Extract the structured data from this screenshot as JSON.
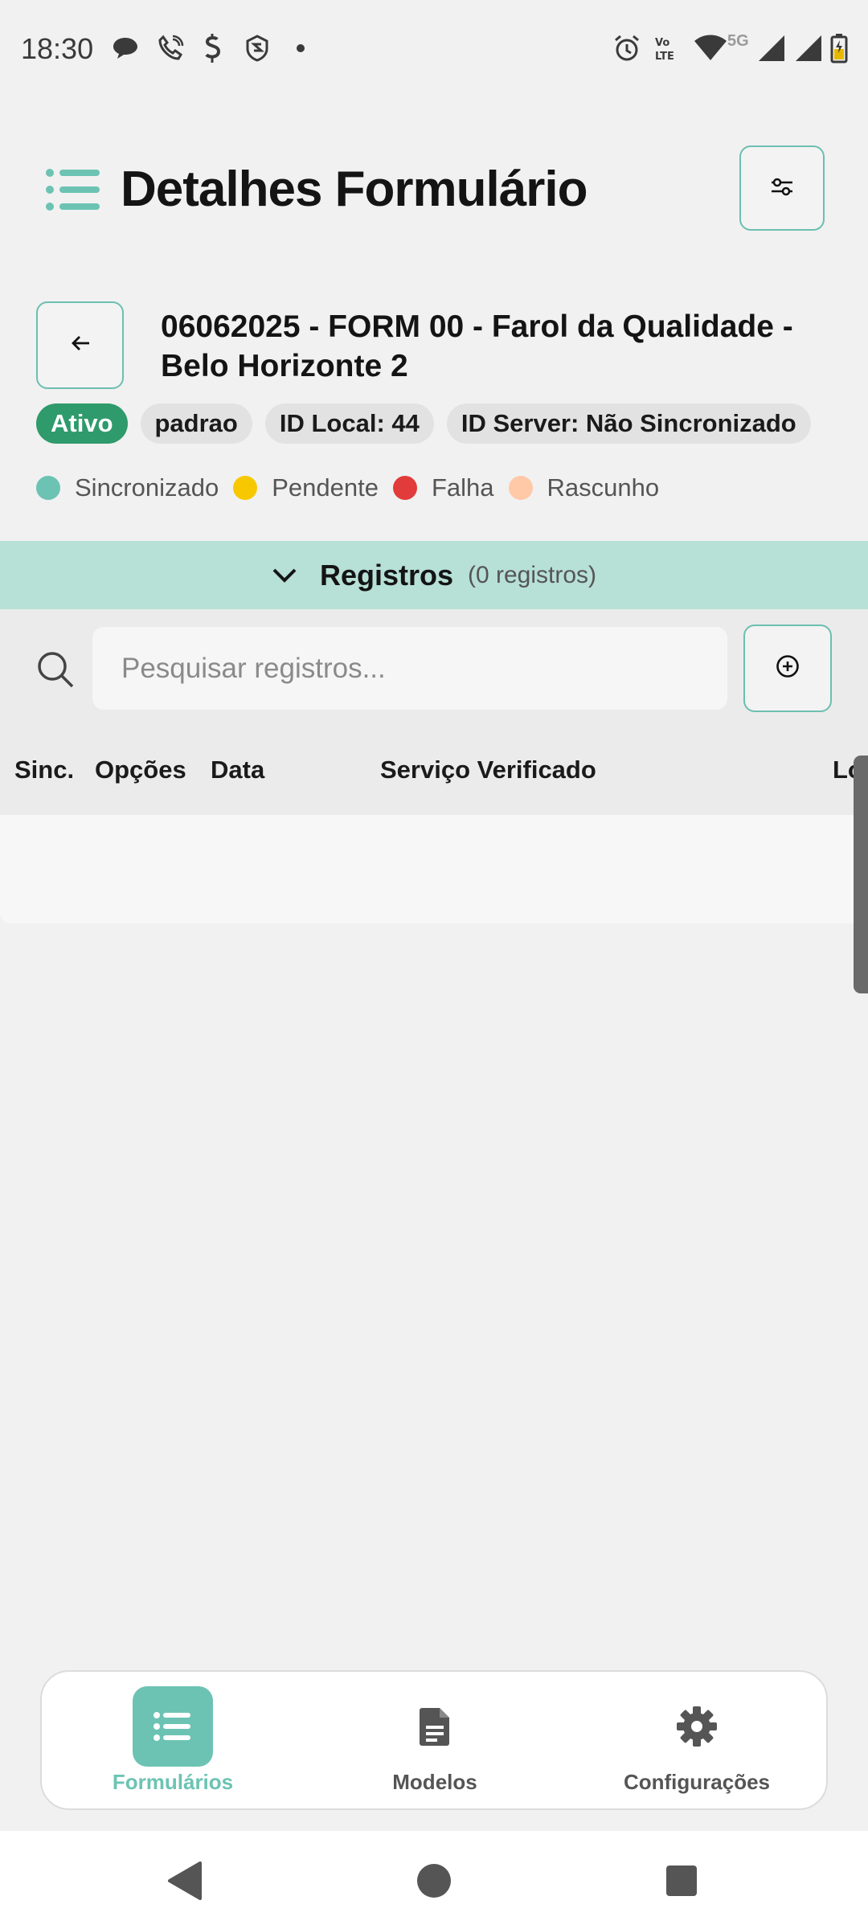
{
  "status_bar": {
    "time": "18:30",
    "network_label": "5G",
    "left_icons": [
      "chat-bubble-icon",
      "phone-call-icon",
      "dollar-s-icon",
      "shield-s-icon",
      "notification-dot-icon"
    ],
    "right_icons": [
      "alarm-icon",
      "volte-icon",
      "wifi-icon",
      "signal-icon",
      "signal-icon",
      "battery-charging-icon"
    ]
  },
  "header": {
    "title": "Detalhes Formulário",
    "menu_icon": "menu-list-icon",
    "filter_icon": "sliders-icon"
  },
  "form": {
    "back_icon": "arrow-left-icon",
    "title": "06062025 - FORM 00 - Farol da Qualidade - Belo Horizonte 2",
    "chips": {
      "status": "Ativo",
      "type": "padrao",
      "local_id": "ID Local: 44",
      "server_id": "ID Server: Não Sincronizado"
    },
    "legend": [
      {
        "label": "Sincronizado",
        "color": "#6cc3b3"
      },
      {
        "label": "Pendente",
        "color": "#f7c800"
      },
      {
        "label": "Falha",
        "color": "#e23b3b"
      },
      {
        "label": "Rascunho",
        "color": "#ffc9a8"
      }
    ]
  },
  "registros": {
    "title": "Registros",
    "count": "(0 registros)",
    "icon": "chevron-down-icon"
  },
  "search": {
    "placeholder": "Pesquisar registros...",
    "value": "",
    "add_icon": "plus-circle-icon"
  },
  "table": {
    "columns": [
      "Sinc.",
      "Opções",
      "Data",
      "Serviço Verificado",
      "Loc"
    ],
    "rows": []
  },
  "bottom_nav": {
    "items": [
      {
        "label": "Formulários",
        "icon": "list-icon",
        "active": true
      },
      {
        "label": "Modelos",
        "icon": "document-icon",
        "active": false
      },
      {
        "label": "Configurações",
        "icon": "gear-icon",
        "active": false
      }
    ]
  },
  "colors": {
    "accent": "#6cc3b3",
    "band": "#b7e0d6",
    "active_chip": "#2f9a6b"
  }
}
